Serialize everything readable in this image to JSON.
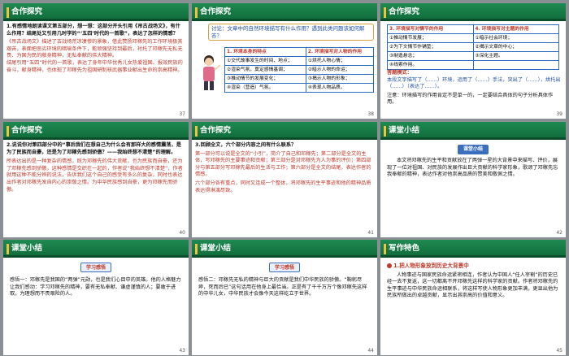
{
  "slides": [
    {
      "num": "37",
      "header": "合作探究",
      "q": "1.有感情地朗读课文第五部分，想一想：这部分开头引用《吊古战场文》，有什么作用？结尾处又引用几时学的“‘五四’时代的一首歌”，表达了怎样的情感？",
      "a1": "《吊古战场文》描述了古战场荒凉凄惨的景象，借此赞扬邓稼先的工作环境极其艰苦，表面把恶劣环境的暗喻条件下，能顽强坚持到最后，衬托了邓稼先无私无畏、为国为民的献身精神，无私奉献的伟大精神。",
      "a2": "结尾引用“五四”时代的一首歌，表达了身年中华优秀儿女热爱祖国、报效民族的奋斗，献身精神，也体现了邓稼先为祖国研制核武器事业献出生命的崇高精神。"
    },
    {
      "num": "38",
      "header": "合作探究",
      "q": "讨论：文章中的自然环境描写有什么作用？遇到此类问题该如何解答？",
      "c1h": "1. 环境本身的特点",
      "c2h": "2. 环境描写对人物的作用",
      "c1": [
        "①交代故事发生的时间、地点；",
        "②渲染气氛，奠定感情基调；",
        "③推动情节的发展变化；",
        "④渲染（营造）气氛。"
      ],
      "c2": [
        "①烘托人物心情；",
        "②暗示人物的命运；",
        "③揭示人物的形象；",
        "④表现人物品质。"
      ]
    },
    {
      "num": "39",
      "header": "合作探究",
      "c1h": "3. 环境描写对情节的作用",
      "c2h": "4. 环境描写对主题的作用",
      "c1": [
        "①推动情节发展；",
        "②为下文情节作铺垫；",
        "③制造悬念；",
        "④线索作用。"
      ],
      "c2": [
        "①暗示社会环境；",
        "②揭示文章的中心；",
        "③深化主题。"
      ],
      "h3": "答题模式：",
      "line1": "本段文字描写了（……）环境，运用了（……）手法，突出了（……），烘托出（……）（表达了……）。",
      "line2": "注意：环境描写的作用肯定不是单一的，一定要结合具体的句子分析具体作用。"
    },
    {
      "num": "40",
      "header": "合作探究",
      "q": "2.说说你对第四部分中的“事后我们在想自己为什么会有那样大的感情震荡，是为了民族而自豪，还是为了邓稼先感到骄傲？——我始终想不清楚”的理解。",
      "a": "所表达出的是一种复杂的情感，既为邓稼先的伟大贡献，也为民族而自豪，还为了邓稼先感到骄傲，这种感情是交织在一起的，作者说“我始终想不清楚”，作者就用这种不能分辨的说法，告诉我们这个自己的感受有多么的复杂，同时也表达出作者对邓稼先发自内心的崇敬之情。为中华民族感到自豪，更为邓稼先而骄傲。"
    },
    {
      "num": "41",
      "header": "合作探究",
      "q": "3.回顾全文，六个部分内容之间有什么联系？",
      "a": "第一部分可以说是全文的“小引”，简介了自己和邓稼先；第二部分是全文的主体，写邓稼先的主要事迹和贡献；第三部分是对邓稼先为人为事的评价；第四部分与第五部分写邓稼先最后的生活与工作；第六部分是全文的结尾，表达作者的情感。",
      "note": "六个部分各有重点，同时又连成一个整体，将邓稼先的生平事迹和他的精神品质表达得淋漓尽致。"
    },
    {
      "num": "42",
      "header": "课堂小结",
      "tag": "课堂小结",
      "a": "本文将邓稼先的生平和贡献放在了两弹一星的大背景中来描写、评价，展现了一位对祖国、对民族的发展作出巨大贡献的科学家形象，歌颂了邓稼先忘我奉献的精神，表达作者对他崇高品质的赞美和敬佩之情。"
    },
    {
      "num": "43",
      "header": "课堂小结",
      "tag": "学习感悟",
      "a": "感悟一：邓稼先是我国的“两弹”元勋，也是我们心目中的英雄。他的人格魅力让我们感动：学习邓稼先的精神，要有无私奉献、谦虚谨慎的人；要敢于进取，为理想而不畏艰险的人。"
    },
    {
      "num": "44",
      "header": "课堂小结",
      "tag": "学习感悟",
      "a": "感悟二：邓稼先无私的精神与巨大的贡献是我们中华民族的骄傲。“鞠躬尽瘁，死而后已”这句话用在他身上最恰当。正是有了千千万万个像邓稼先这样的中华儿女，中华民族才会像今天这样屹立于世界。"
    },
    {
      "num": "45",
      "header": "写作特色",
      "h": "1.把人物形象放到历史大背景中",
      "a": "人物事迹与国家民族命运紧密相连，作者认为中国人“任人宰割”的历史已经一去不复返，这一切都离不开邓稼先这样的科学家的贡献。作者将邓稼先的生平事迹与中华民族命运相联系，将这样写使人物形象更加丰满，更显出他为民族所做出的卓越贡献，显示出其崇高的价值和意义。"
    }
  ]
}
